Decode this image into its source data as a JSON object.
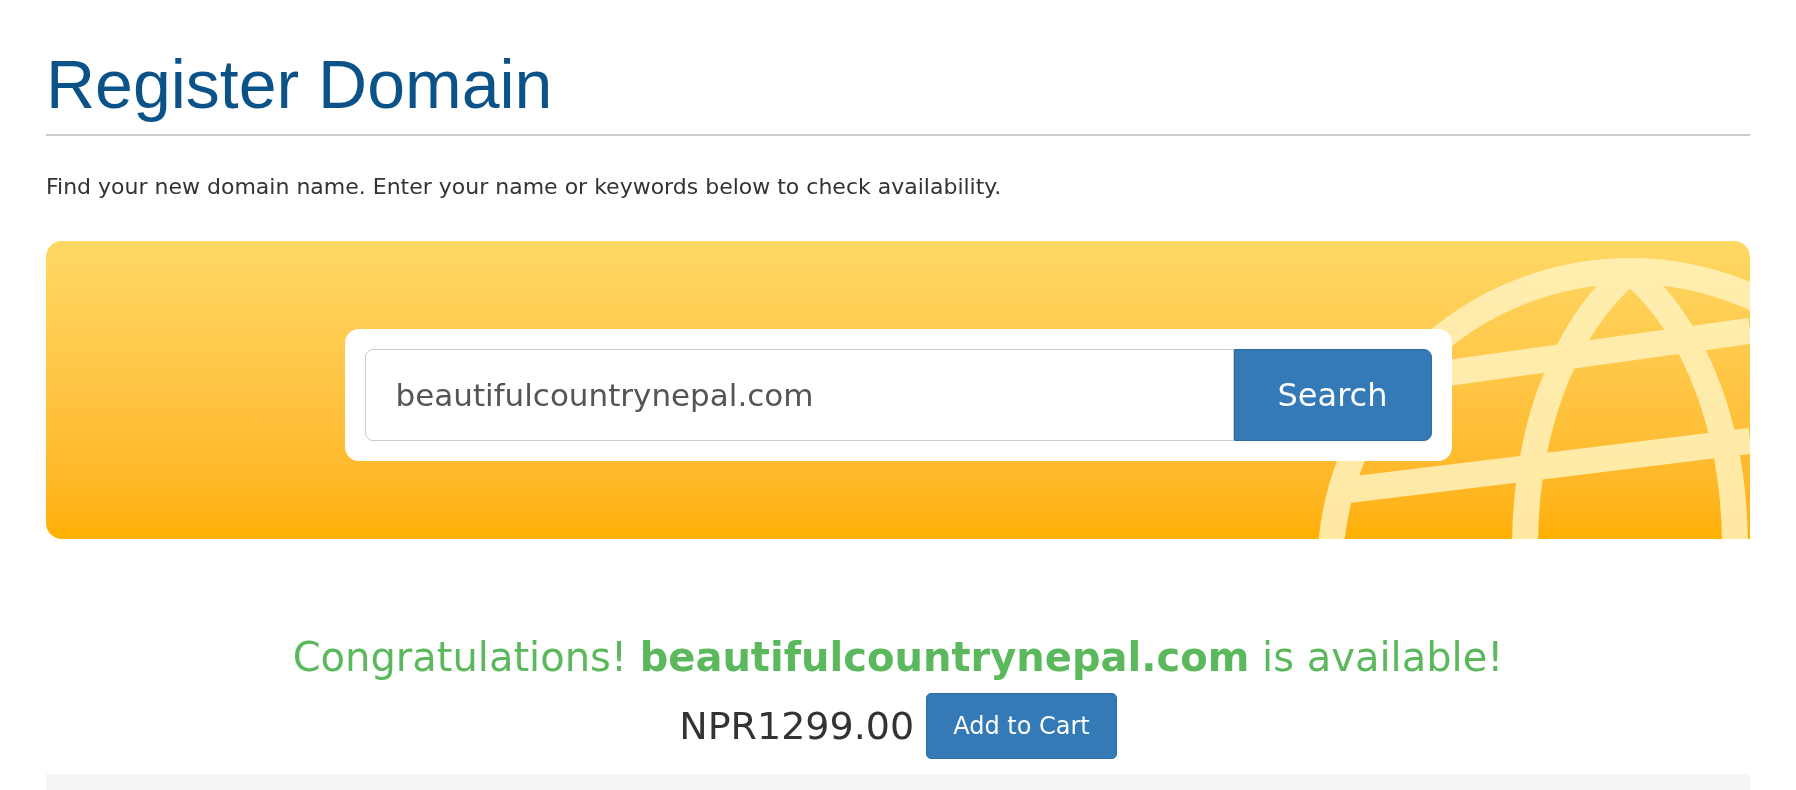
{
  "title": "Register Domain",
  "intro": "Find your new domain name. Enter your name or keywords below to check availability.",
  "search": {
    "value": "beautifulcountrynepal.com",
    "button": "Search"
  },
  "result": {
    "message": "Congratulations! **beautifulcountrynepal.com** is available!",
    "price": "NPR1299.00",
    "button": "Add to Cart"
  }
}
